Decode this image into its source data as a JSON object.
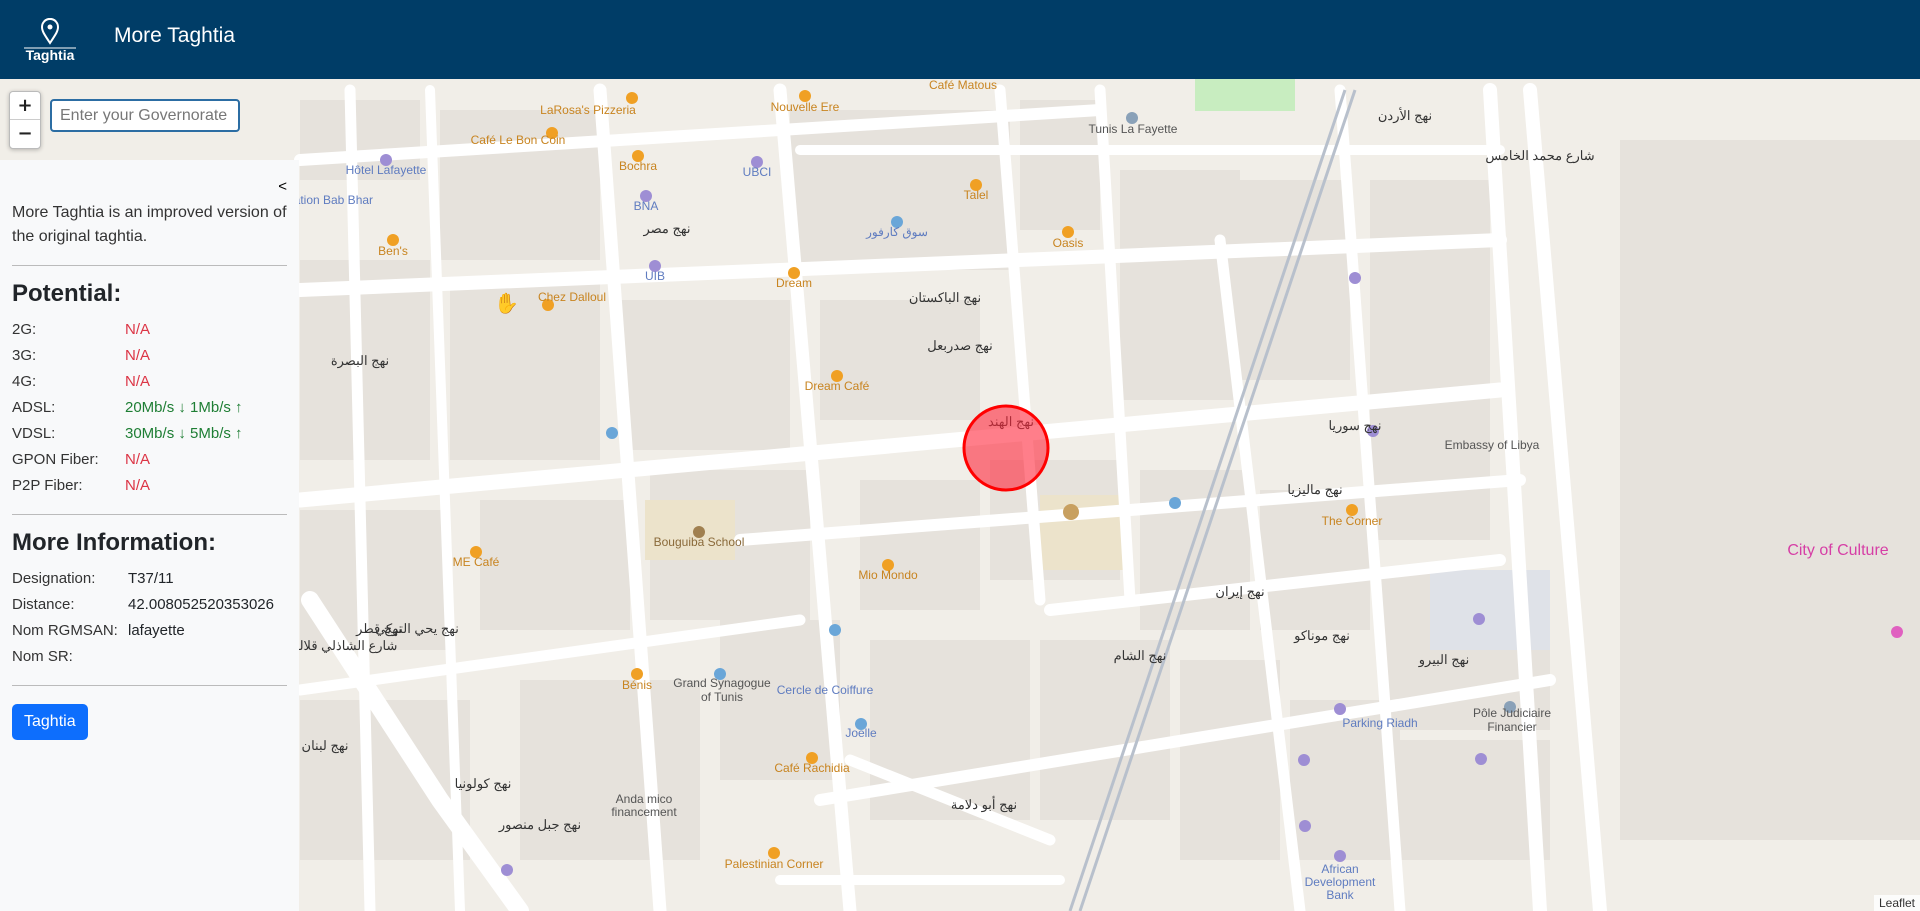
{
  "header": {
    "logo_text": "Taghtia",
    "title": "More Taghtia"
  },
  "map": {
    "zoom_in": "+",
    "zoom_out": "−",
    "governorate_placeholder": "Enter your Governorate",
    "attribution": "Leaflet",
    "marker_color": "#ff0000",
    "labels": [
      {
        "text": "LaRosa's Pizzeria",
        "c": "poi"
      },
      {
        "text": "Nouvelle Ere",
        "c": "poi"
      },
      {
        "text": "Café Matous",
        "c": "poi"
      },
      {
        "text": "Tunis La Fayette",
        "c": "gray"
      },
      {
        "text": "Café Le Bon Coin",
        "c": "poi"
      },
      {
        "text": "Hôtel Lafayette",
        "c": "blue"
      },
      {
        "text": "Bochra",
        "c": "poi"
      },
      {
        "text": "UBCI",
        "c": "blue"
      },
      {
        "text": "BNA",
        "c": "blue"
      },
      {
        "text": "gation Bab Bhar",
        "c": "blue"
      },
      {
        "text": "Talel",
        "c": "poi"
      },
      {
        "text": "سوق كارفور",
        "c": "blue"
      },
      {
        "text": "Oasis",
        "c": "poi"
      },
      {
        "text": "Ben's",
        "c": "poi"
      },
      {
        "text": "UIB",
        "c": "blue"
      },
      {
        "text": "Dream",
        "c": "poi"
      },
      {
        "text": "Chez Dalloul",
        "c": "poi"
      },
      {
        "text": "Dream Café",
        "c": "poi"
      },
      {
        "text": "Embassy of Libya",
        "c": "gray"
      },
      {
        "text": "The Corner",
        "c": "poi"
      },
      {
        "text": "Bouguiba School",
        "c": "brown"
      },
      {
        "text": "ME Café",
        "c": "poi"
      },
      {
        "text": "Mio Mondo",
        "c": "poi"
      },
      {
        "text": "City of Culture",
        "c": "pink"
      },
      {
        "text": "Grand Synagogue",
        "c": "gray"
      },
      {
        "text": "of Tunis",
        "c": "gray"
      },
      {
        "text": "Cercle de Coiffure",
        "c": "blue"
      },
      {
        "text": "Bénis",
        "c": "poi"
      },
      {
        "text": "Joelle",
        "c": "blue"
      },
      {
        "text": "Parking Riadh",
        "c": "blue"
      },
      {
        "text": "Pôle Judiciaire",
        "c": "gray"
      },
      {
        "text": "Financier",
        "c": "gray"
      },
      {
        "text": "Café Rachidia",
        "c": "poi"
      },
      {
        "text": "Anda mico",
        "c": "gray"
      },
      {
        "text": "financement",
        "c": "gray"
      },
      {
        "text": "Palestinian Corner",
        "c": "poi"
      },
      {
        "text": "African",
        "c": "blue"
      },
      {
        "text": "Development",
        "c": "blue"
      },
      {
        "text": "Bank",
        "c": "blue"
      },
      {
        "text": "نهج الهند",
        "c": "street"
      },
      {
        "text": "نهج الباكستان",
        "c": "street"
      },
      {
        "text": "نهج الأردن",
        "c": "street"
      },
      {
        "text": "نهج مصر",
        "c": "street"
      },
      {
        "text": "نهج سوريا",
        "c": "street"
      },
      {
        "text": "نهج ماليزيا",
        "c": "street"
      },
      {
        "text": "نهج إيران",
        "c": "street"
      },
      {
        "text": "نهج الشام",
        "c": "street"
      },
      {
        "text": "نهج يحي التركي",
        "c": "street"
      },
      {
        "text": "نهج موناكو",
        "c": "street"
      },
      {
        "text": "نهج البيرو",
        "c": "street"
      },
      {
        "text": "نهج قطر",
        "c": "street"
      },
      {
        "text": "نهج أبو دلامة",
        "c": "street"
      },
      {
        "text": "نهج جبل منصور",
        "c": "street"
      },
      {
        "text": "نهج كولونيا",
        "c": "street"
      },
      {
        "text": "نهج البصرة",
        "c": "street"
      },
      {
        "text": "نهج صدربعل",
        "c": "street"
      },
      {
        "text": "شارع محمد الخامس",
        "c": "street"
      },
      {
        "text": "شارع الشاذلي قلالة",
        "c": "street"
      },
      {
        "text": "نهج لبنان",
        "c": "street"
      }
    ]
  },
  "panel": {
    "collapse": "<",
    "intro": "More Taghtia is an improved version of the original taghtia.",
    "potential_title": "Potential:",
    "potential": [
      {
        "label": "2G:",
        "value": "N/A",
        "status": "na"
      },
      {
        "label": "3G:",
        "value": "N/A",
        "status": "na"
      },
      {
        "label": "4G:",
        "value": "N/A",
        "status": "na"
      },
      {
        "label": "ADSL:",
        "value": "20Mb/s ↓ 1Mb/s ↑",
        "status": "ok"
      },
      {
        "label": "VDSL:",
        "value": "30Mb/s ↓ 5Mb/s ↑",
        "status": "ok"
      },
      {
        "label": "GPON Fiber:",
        "value": "N/A",
        "status": "na"
      },
      {
        "label": "P2P Fiber:",
        "value": "N/A",
        "status": "na"
      }
    ],
    "more_title": "More Information:",
    "info": [
      {
        "label": "Designation:",
        "value": "T37/11"
      },
      {
        "label": "Distance:",
        "value": "42.008052520353026"
      },
      {
        "label": "Nom RGMSAN:",
        "value": "lafayette"
      },
      {
        "label": "Nom SR:",
        "value": ""
      }
    ],
    "button": "Taghtia"
  }
}
